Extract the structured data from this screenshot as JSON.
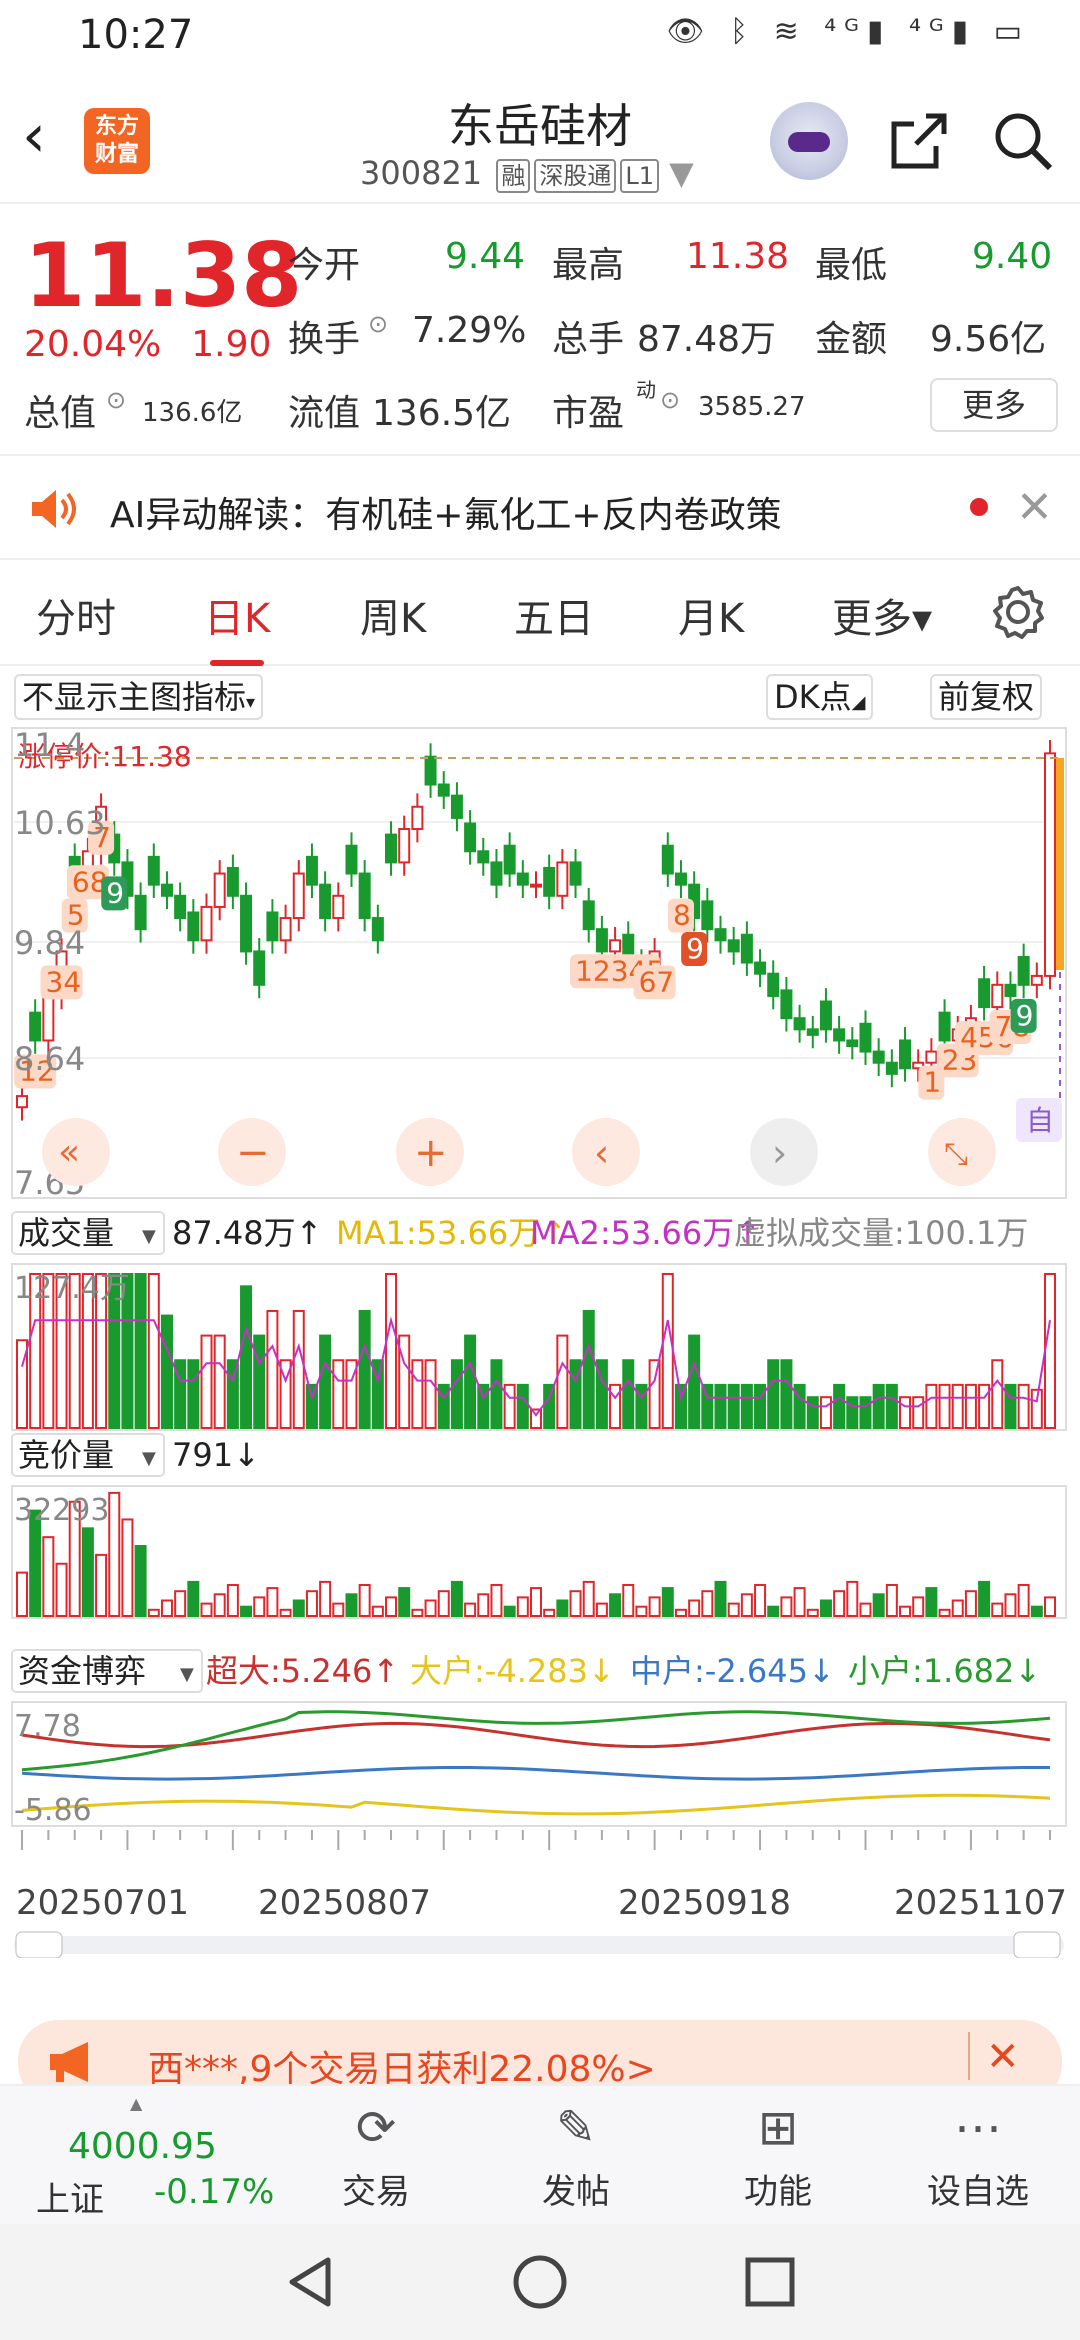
{
  "status_bar": {
    "time": "10:27",
    "icons": "👁 ᛒ ≋ ⁴ᴳ▮ ⁴ᴳ▮ ▭"
  },
  "header": {
    "logo_line1": "东方",
    "logo_line2": "财富",
    "title": "东岳硅材",
    "code": "300821",
    "tags": [
      "融",
      "深股通",
      "L1"
    ]
  },
  "quote": {
    "price": "11.38",
    "change_pct": "20.04%",
    "change": "1.90",
    "open_label": "今开",
    "open": "9.44",
    "high_label": "最高",
    "high": "11.38",
    "low_label": "最低",
    "low": "9.40",
    "turnover_label": "换手",
    "turnover": "7.29%",
    "volume_label": "总手",
    "volume": "87.48万",
    "amount_label": "金额",
    "amount": "9.56亿",
    "mktcap_label": "总值",
    "mktcap": "136.6亿",
    "float_label": "流值",
    "float": "136.5亿",
    "pe_label": "市盈",
    "pe_sup": "动",
    "pe": "3585.27",
    "more": "更多"
  },
  "ai_bar": {
    "text": "AI异动解读：有机硅+氟化工+反内卷政策"
  },
  "tabs": [
    "分时",
    "日K",
    "周K",
    "五日",
    "月K",
    "更多▾"
  ],
  "chart_controls": {
    "indicator_select": "不显示主图指标",
    "dk": "DK点",
    "adjust": "前复权",
    "auto_label": "自"
  },
  "chart_data": [
    {
      "type": "candlestick",
      "title": "日K",
      "ylabels": [
        "11.4",
        "10.63",
        "9.84",
        "8.64",
        "7.65"
      ],
      "limit_label": "涨停价:11.38",
      "x_ticks": [
        "20250701",
        "20250807",
        "20250918",
        "20251107"
      ],
      "close": [
        8.3,
        8.8,
        9.2,
        9.6,
        10.2,
        10.5,
        10.9,
        10.4,
        10.1,
        9.8,
        10.2,
        10.1,
        9.9,
        9.7,
        10.0,
        10.3,
        10.1,
        9.6,
        9.3,
        9.7,
        9.9,
        10.3,
        10.2,
        9.9,
        10.1,
        10.3,
        9.9,
        9.7,
        10.4,
        10.7,
        10.9,
        11.1,
        11.0,
        10.8,
        10.5,
        10.4,
        10.2,
        10.3,
        10.2,
        10.2,
        10.1,
        10.4,
        10.2,
        9.8,
        9.6,
        9.7,
        9.5,
        9.4,
        9.6,
        10.3,
        10.2,
        9.9,
        9.8,
        9.7,
        9.6,
        9.5,
        9.4,
        9.2,
        9.0,
        8.9,
        8.85,
        8.9,
        8.8,
        8.75,
        8.7,
        8.6,
        8.5,
        8.55,
        8.6,
        8.7,
        8.8,
        8.9,
        9.0,
        9.1,
        9.3,
        9.2,
        9.3,
        9.38,
        11.38
      ],
      "events": [
        {
          "label": "12",
          "i": 1
        },
        {
          "label": "34",
          "i": 3
        },
        {
          "label": "7",
          "i": 6
        },
        {
          "label": "5",
          "i": 4
        },
        {
          "label": "68",
          "i": 5
        },
        {
          "label": "9",
          "i": 7
        },
        {
          "label": "12345",
          "i": 45
        },
        {
          "label": "67",
          "i": 48
        },
        {
          "label": "8",
          "i": 50
        },
        {
          "label": "9",
          "i": 51
        },
        {
          "label": "1",
          "i": 69
        },
        {
          "label": "23",
          "i": 71
        },
        {
          "label": "456",
          "i": 73
        },
        {
          "label": "78",
          "i": 75
        },
        {
          "label": "9",
          "i": 76
        }
      ]
    },
    {
      "type": "bar",
      "title": "成交量",
      "summary": "87.48万↑",
      "ma1": "MA1:53.66万↑",
      "ma2": "MA2:53.66万↑",
      "virtual": "虚拟成交量:100.1万",
      "ylabel_top": "127.4万"
    },
    {
      "type": "bar",
      "title": "竞价量",
      "summary": "791↓",
      "ylabel_top": "32293"
    },
    {
      "type": "line",
      "title": "资金博弈",
      "series": [
        {
          "name": "超大",
          "label": "超大:5.246↑",
          "color": "#c7322e"
        },
        {
          "name": "大户",
          "label": "大户:-4.283↓",
          "color": "#e6c419"
        },
        {
          "name": "中户",
          "label": "中户:-2.645↓",
          "color": "#3a78c4"
        },
        {
          "name": "小户",
          "label": "小户:1.682↓",
          "color": "#2a9a2e"
        }
      ],
      "ylabels": [
        "7.78",
        "-5.86"
      ]
    }
  ],
  "promo": {
    "text": "西***,9个交易日获利22.08%>"
  },
  "bottom": {
    "index_value": "4000.95",
    "index_name": "上证",
    "index_change": "-0.17%",
    "items": [
      {
        "label": "交易",
        "icon": "trade-icon"
      },
      {
        "label": "发帖",
        "icon": "post-icon"
      },
      {
        "label": "功能",
        "icon": "apps-icon"
      },
      {
        "label": "设自选",
        "icon": "watchlist-icon"
      }
    ]
  }
}
